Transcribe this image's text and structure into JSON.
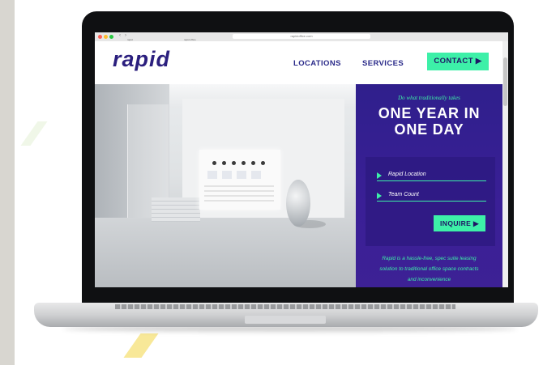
{
  "browser": {
    "url": "rapidoffice.com",
    "tabs": [
      "rapid",
      "rapid office"
    ]
  },
  "site": {
    "logo": "rapid",
    "nav": [
      {
        "label": "LOCATIONS"
      },
      {
        "label": "SERVICES"
      }
    ],
    "contact_label": "CONTACT ▶"
  },
  "hero": {
    "tagline": "Do what traditionally takes",
    "headline_line1": "ONE YEAR IN",
    "headline_line2": "ONE DAY",
    "form": {
      "field_1": "Rapid Location",
      "field_2": "Team Count",
      "submit_label": "INQUIRE ▶"
    },
    "description": [
      "Rapid is a hassle-free, spec suite leasing",
      "solution to traditional office space contracts",
      "and inconvenience"
    ]
  },
  "colors": {
    "brand_purple": "#2f1f8c",
    "accent_green": "#3df0a8",
    "nav_text": "#2b2b8a"
  },
  "icons": {
    "arrow": "play-triangle-icon"
  }
}
